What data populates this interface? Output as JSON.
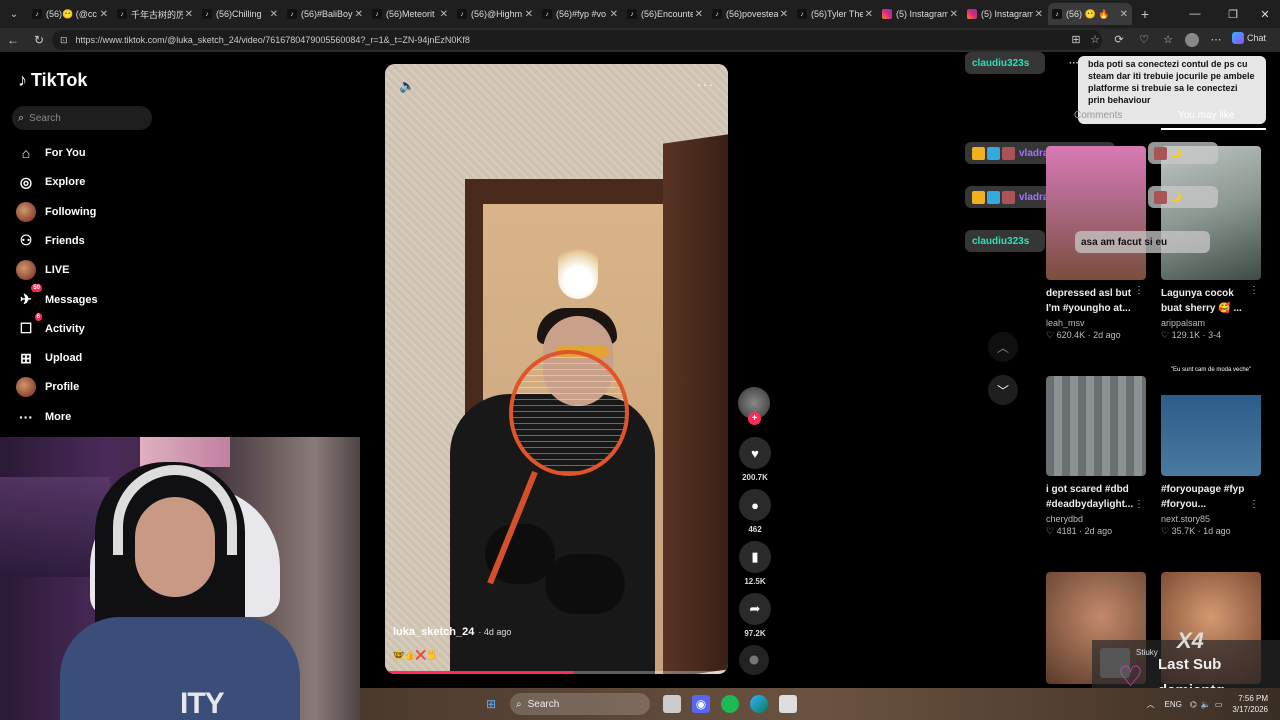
{
  "browser": {
    "tabs": [
      {
        "title": "(56)😶 (@cc",
        "icon": "tiktok-icon"
      },
      {
        "title": "千年古树的厉",
        "icon": "tiktok-icon"
      },
      {
        "title": "(56)Chilling",
        "icon": "tiktok-icon"
      },
      {
        "title": "(56)#BaliBoy",
        "icon": "tiktok-icon"
      },
      {
        "title": "(56)Meteorit",
        "icon": "tiktok-icon"
      },
      {
        "title": "(56)@Highm",
        "icon": "tiktok-icon"
      },
      {
        "title": "(56)#fyp #vo",
        "icon": "tiktok-icon"
      },
      {
        "title": "(56)Encounte",
        "icon": "tiktok-icon"
      },
      {
        "title": "(56)povestea",
        "icon": "tiktok-icon"
      },
      {
        "title": "(56)Tyler The",
        "icon": "tiktok-icon"
      },
      {
        "title": "(5) Instagram",
        "icon": "instagram-icon"
      },
      {
        "title": "(5) Instagram",
        "icon": "instagram-icon"
      },
      {
        "title": "(56) 😶 🔥",
        "icon": "tiktok-icon"
      }
    ],
    "url": "https://www.tiktok.com/@luka_sketch_24/video/7616780479005560084?_r=1&_t=ZN-94jnEzN0Kf8",
    "chat_label": "Chat"
  },
  "sidebar": {
    "logo": "TikTok",
    "search_placeholder": "Search",
    "items": [
      {
        "label": "For You",
        "icon": "home-icon"
      },
      {
        "label": "Explore",
        "icon": "compass-icon"
      },
      {
        "label": "Following",
        "icon": "avatar-icon"
      },
      {
        "label": "Friends",
        "icon": "friends-icon"
      },
      {
        "label": "LIVE",
        "icon": "avatar-icon"
      },
      {
        "label": "Messages",
        "icon": "message-icon",
        "badge": "50"
      },
      {
        "label": "Activity",
        "icon": "activity-icon",
        "badge": "6"
      },
      {
        "label": "Upload",
        "icon": "plus-square-icon"
      },
      {
        "label": "Profile",
        "icon": "avatar-icon"
      },
      {
        "label": "More",
        "icon": "more-icon"
      }
    ]
  },
  "video": {
    "username": "luka_sketch_24",
    "posted": "· 4d ago",
    "emojis": "🤓👍❌🖐",
    "progress": 0.55
  },
  "actions": {
    "likes": "200.7K",
    "comments": "462",
    "saves": "12.5K",
    "shares": "97.2K"
  },
  "chat_overlay": [
    {
      "user": "claudiu323s",
      "kind": "claud"
    },
    {
      "user": "vladrasasuke",
      "kind": "vlad"
    },
    {
      "user": "vladrasasuke",
      "kind": "vlad"
    },
    {
      "user": "claudiu323s",
      "kind": "claud"
    }
  ],
  "chat_message": "bda poti sa conectezi contul de ps cu steam dar iti trebuie jocurile pe ambele platforme si trebuie sa le conectezi prin behaviour",
  "chat_reply": "asa am facut si eu",
  "panel": {
    "tabs": {
      "comments": "Comments",
      "you_may_like": "You may like"
    },
    "cards": [
      {
        "title": "depressed asl but\nI'm #youngho at...",
        "user": "leah_msv",
        "views": "620.4K",
        "ago": "2d ago"
      },
      {
        "title": "Lagunya cocok\nbuat sherry 🥰 ...",
        "user": "arippalsam",
        "views": "129.1K",
        "ago": "3-4"
      },
      {
        "title": "i got scared #dbd\n#deadbydaylight...",
        "user": "cherydbd",
        "views": "4181",
        "ago": "2d ago"
      },
      {
        "title": "#foryoupage #fyp\n#foryou...",
        "user": "next.story85",
        "views": "35.7K",
        "ago": "1d ago"
      }
    ],
    "thumb_caption": "\"Eu sunt cam de moda veche\""
  },
  "sub_alert": {
    "multiplier": "X4",
    "label": "Last Sub",
    "name": "damiantg",
    "who": "Stiuky"
  },
  "taskbar": {
    "search": "Search",
    "lang": "ENG",
    "time": "7:56 PM",
    "date": "3/17/2026"
  }
}
